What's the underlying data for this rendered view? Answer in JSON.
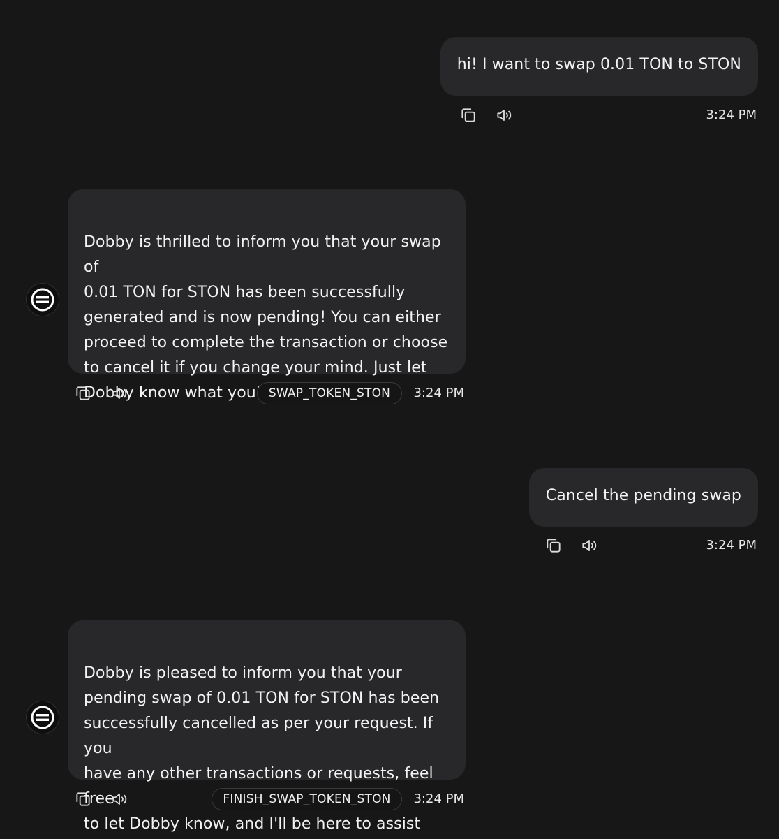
{
  "messages": [
    {
      "role": "user",
      "text": "hi! I want to swap 0.01 TON to STON",
      "time": "3:24 PM"
    },
    {
      "role": "assistant",
      "text": "Dobby is thrilled to inform you that your swap of\n0.01 TON for STON has been successfully\ngenerated and is now pending! You can either\nproceed to complete the transaction or choose\nto cancel it if you change your mind. Just let\nDobby know what you'd like to do next!",
      "action": "SWAP_TOKEN_STON",
      "time": "3:24 PM"
    },
    {
      "role": "user",
      "text": "Cancel the pending swap",
      "time": "3:24 PM"
    },
    {
      "role": "assistant",
      "text": "Dobby is pleased to inform you that your\npending swap of 0.01 TON for STON has been\nsuccessfully cancelled as per your request. If you\nhave any other transactions or requests, feel free\nto let Dobby know, and I'll be here to assist you!",
      "action": "FINISH_SWAP_TOKEN_STON",
      "time": "3:24 PM"
    }
  ],
  "icons": {
    "copy": "copy-icon",
    "speak": "speaker-icon",
    "avatar": "agent-logo-icon"
  },
  "colors": {
    "background": "#171717",
    "bubble": "#28282b",
    "text": "#f3f3f3",
    "tag_border": "#3a3a3d"
  }
}
